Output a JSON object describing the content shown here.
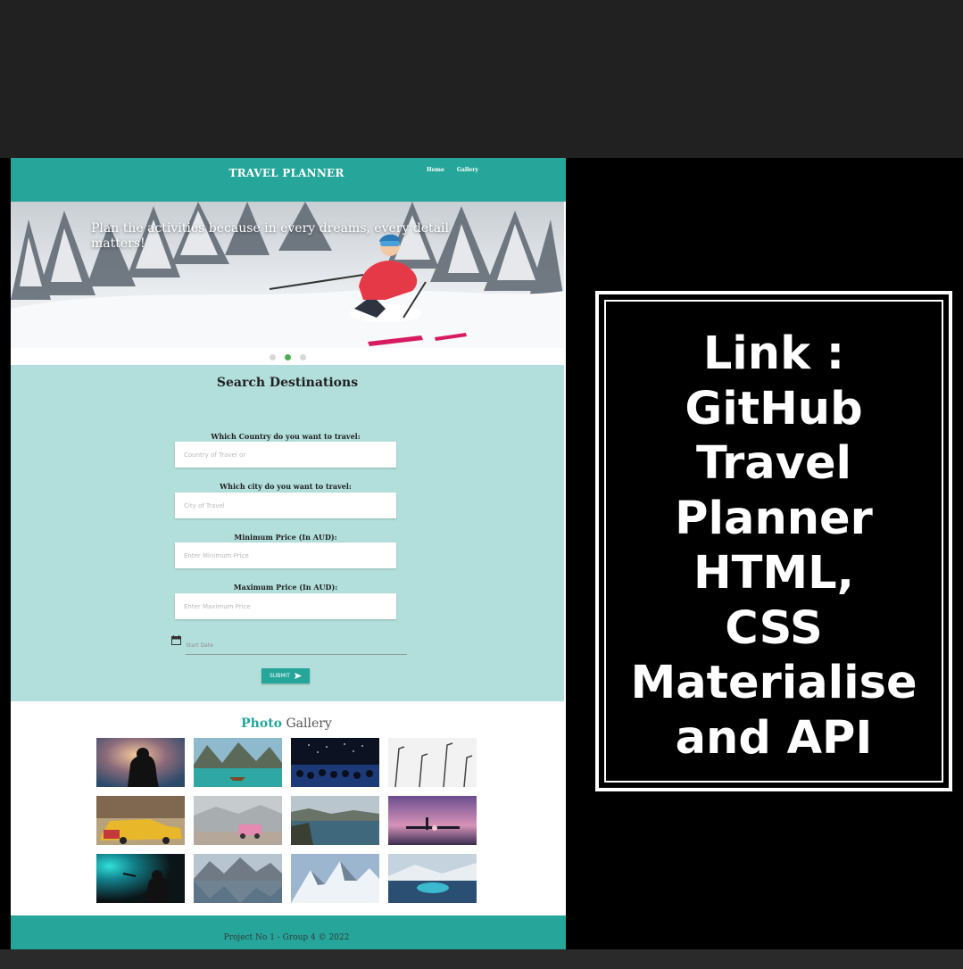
{
  "site": {
    "brand": "TRAVEL PLANNER",
    "nav": [
      "Home",
      "Gallery"
    ],
    "hero": {
      "caption": "Plan the activities because in every dreams, every detail matters!",
      "slides_total": 3,
      "active_slide": 2
    },
    "search": {
      "title": "Search Destinations",
      "fields": [
        {
          "label": "Which Country do you want to travel:",
          "placeholder": "Country of Travel or"
        },
        {
          "label": "Which city do you want to travel:",
          "placeholder": "City of Travel"
        },
        {
          "label": "Minimum Price (In AUD):",
          "placeholder": "Enter Minimum Price"
        },
        {
          "label": "Maximum Price (In AUD):",
          "placeholder": "Enter Maximum Price"
        }
      ],
      "date_placeholder": "Start Date",
      "submit_label": "SUBMIT"
    },
    "gallery": {
      "title_part1": "Photo",
      "title_part2": "Gallery",
      "photos": [
        "photographer silhouette",
        "turquoise lake",
        "concert crowd",
        "street lamps",
        "yellow taxi",
        "pink jeep in fog",
        "coastline",
        "pink sunset pier",
        "singer spotlight",
        "mountain lake",
        "snowy peaks",
        "cruise ship deck"
      ]
    },
    "footer": "Project No 1 - Group 4 © 2022",
    "colors": {
      "primary": "#26a69a",
      "search_bg": "#b2dfdb",
      "active_dot": "#4caf50"
    }
  },
  "overlay": {
    "text": "Link :\nGitHub\nTravel\nPlanner\n HTML,\nCSS\nMaterialise\nand API"
  }
}
